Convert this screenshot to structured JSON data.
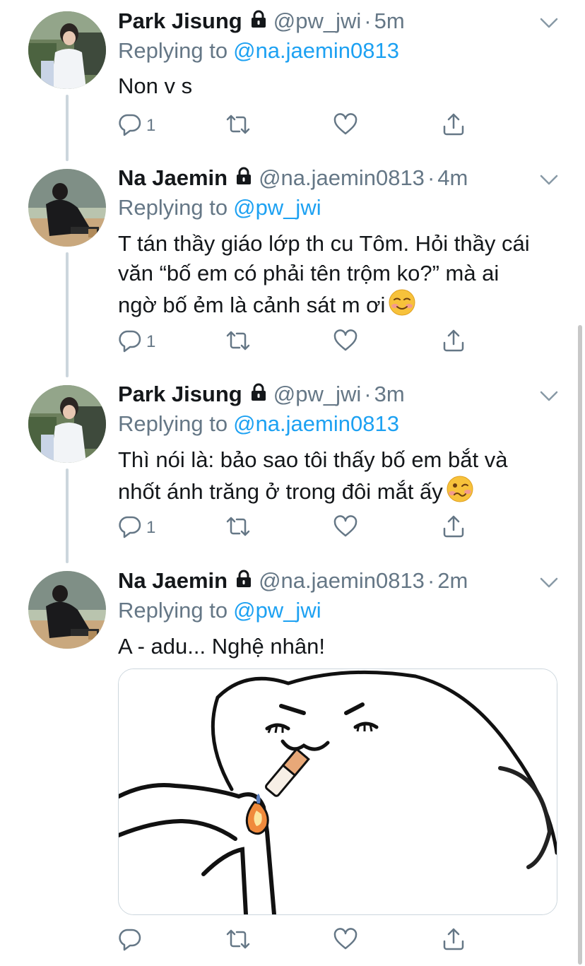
{
  "tweets": [
    {
      "name": "Park Jisung",
      "handle": "@pw_jwi",
      "dot": "·",
      "time": "5m",
      "replying_prefix": "Replying to",
      "replying_to": "@na.jaemin0813",
      "text": "Non v s",
      "reply_count": "1",
      "avatar": "park-jisung-avatar"
    },
    {
      "name": "Na Jaemin",
      "handle": "@na.jaemin0813",
      "dot": "·",
      "time": "4m",
      "replying_prefix": "Replying to",
      "replying_to": "@pw_jwi",
      "text_lines": [
        "T tán thầy giáo lớp th cu Tôm. Hỏi thầy cái",
        "văn “bố em có phải tên trộm ko?” mà ai",
        "ngờ bố ẻm là cảnh sát m ơi"
      ],
      "emoji": "smiling-face-emoji",
      "reply_count": "1",
      "avatar": "na-jaemin-avatar"
    },
    {
      "name": "Park Jisung",
      "handle": "@pw_jwi",
      "dot": "·",
      "time": "3m",
      "replying_prefix": "Replying to",
      "replying_to": "@na.jaemin0813",
      "text_lines": [
        "Thì nói là: bảo sao tôi thấy bố em bắt và",
        "nhốt ánh trăng ở trong đôi mắt ấy"
      ],
      "emoji": "woozy-face-emoji",
      "reply_count": "1",
      "avatar": "park-jisung-avatar"
    },
    {
      "name": "Na Jaemin",
      "handle": "@na.jaemin0813",
      "dot": "·",
      "time": "2m",
      "replying_prefix": "Replying to",
      "replying_to": "@pw_jwi",
      "text": "A - adu... Nghệ nhân!",
      "reply_count": "",
      "avatar": "na-jaemin-avatar",
      "media": "meme-image-cat-lighting-cigarette"
    }
  ],
  "icons": {
    "lock": "lock-icon",
    "caret": "chevron-down-icon",
    "reply": "reply-icon",
    "retweet": "retweet-icon",
    "like": "heart-icon",
    "share": "share-icon"
  },
  "colors": {
    "text": "#14171a",
    "secondary": "#657786",
    "link": "#1da1f2",
    "divider": "#ccd6dd"
  }
}
